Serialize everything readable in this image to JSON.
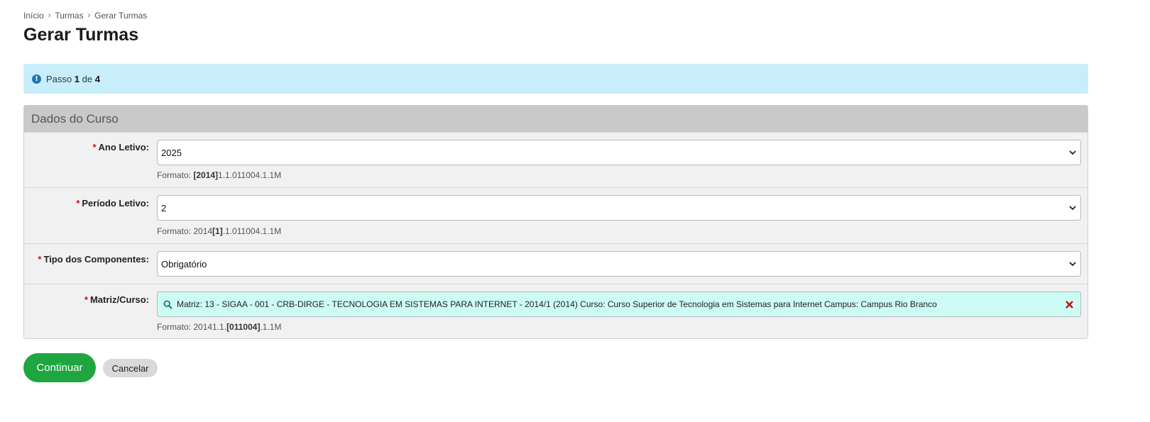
{
  "breadcrumb": [
    "Início",
    "Turmas",
    "Gerar Turmas"
  ],
  "page": {
    "title": "Gerar Turmas"
  },
  "step": {
    "prefix": "Passo",
    "current": "1",
    "of": "de",
    "total": "4"
  },
  "panel": {
    "title": "Dados do Curso"
  },
  "form": {
    "ano": {
      "label": "Ano Letivo:",
      "value": "2025",
      "hint_prefix": "Formato: ",
      "hint_bold": "[2014]",
      "hint_suffix": "1.1.011004.1.1M"
    },
    "periodo": {
      "label": "Período Letivo:",
      "value": "2",
      "hint_prefix": "Formato: 2014",
      "hint_bold": "[1]",
      "hint_suffix": ".1.011004.1.1M"
    },
    "tipo": {
      "label": "Tipo dos Componentes:",
      "value": "Obrigatório"
    },
    "matriz": {
      "label": "Matriz/Curso:",
      "value": "Matriz: 13 - SIGAA - 001 - CRB-DIRGE - TECNOLOGIA EM SISTEMAS PARA INTERNET - 2014/1 (2014) Curso: Curso Superior de Tecnologia em Sistemas para Internet Campus: Campus Rio Branco",
      "hint_prefix": "Formato: 20141.1.",
      "hint_bold": "[011004]",
      "hint_suffix": ".1.1M"
    },
    "required_mark": "*"
  },
  "actions": {
    "continue": "Continuar",
    "cancel": "Cancelar"
  },
  "icons": {
    "info": "info-icon",
    "search": "search-icon",
    "clear": "close-icon",
    "select": "chevron-down-icon"
  },
  "colors": {
    "alert_bg": "#c9eefb",
    "primary": "#20a640",
    "required": "#cc1111",
    "matriz_bg": "#ccfcf3"
  }
}
